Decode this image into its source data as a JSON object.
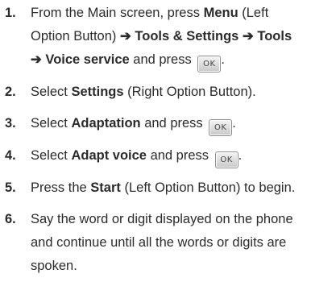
{
  "steps": [
    {
      "num": "1.",
      "t1": "From the Main screen, press ",
      "b1": "Menu",
      "t2": " (Left Option Button) ",
      "arrow1": "➔",
      "b2": " Tools & Settings ",
      "arrow2": "➔",
      "b3": " Tools ",
      "arrow3": "➔",
      "b4": " Voice service",
      "t3": " and press ",
      "key": "OK",
      "end": "."
    },
    {
      "num": "2.",
      "t1": "Select ",
      "b1": "Settings",
      "t2": " (Right Option Button)."
    },
    {
      "num": "3.",
      "t1": "Select ",
      "b1": "Adaptation",
      "t2": " and press ",
      "key": "OK",
      "end": "."
    },
    {
      "num": "4.",
      "t1": "Select ",
      "b1": "Adapt voice",
      "t2": " and press ",
      "key": "OK",
      "end": "."
    },
    {
      "num": "5.",
      "t1": "Press the ",
      "b1": "Start",
      "t2": " (Left Option Button) to begin."
    },
    {
      "num": "6.",
      "t1": "Say the word or digit displayed on the phone and continue until all the words or digits are spoken."
    }
  ]
}
